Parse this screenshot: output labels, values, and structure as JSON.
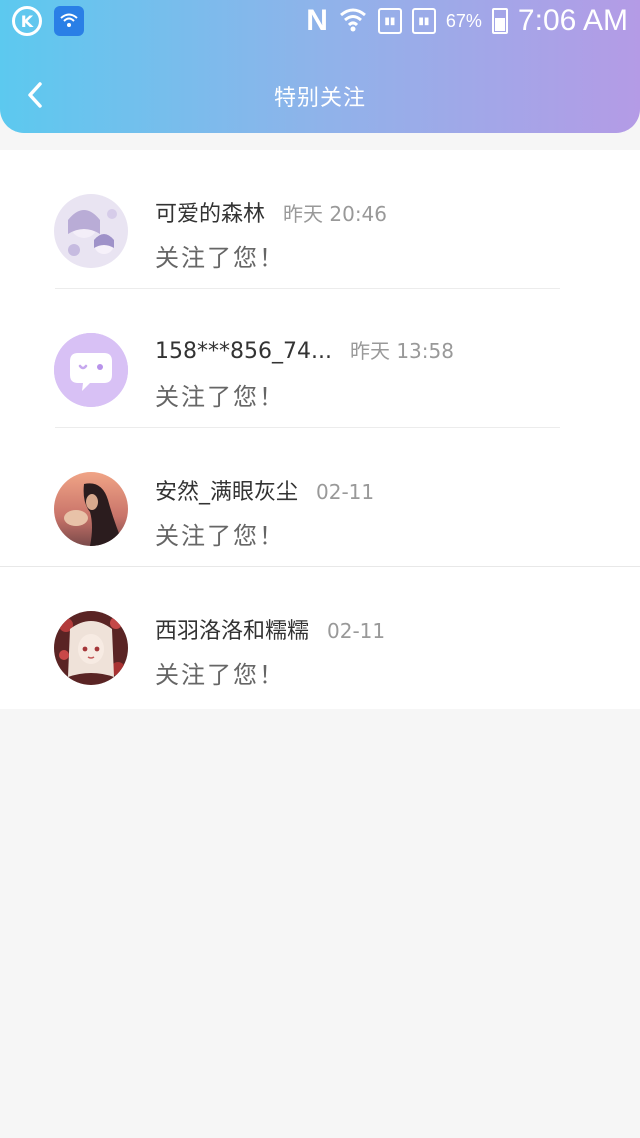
{
  "status_bar": {
    "battery": "67%",
    "time": "7:06 AM"
  },
  "nav": {
    "title": "特别关注"
  },
  "items": [
    {
      "name": "可爱的森林",
      "time": "昨天 20:46",
      "message": "关注了您！",
      "avatar": "avatar-anime-girl-purple"
    },
    {
      "name": "158***856_74...",
      "time": "昨天 13:58",
      "message": "关注了您！",
      "avatar": "avatar-default-chat-bubble"
    },
    {
      "name": "安然_满眼灰尘",
      "time": "02-11",
      "message": "关注了您！",
      "avatar": "avatar-photo-sunset-girl"
    },
    {
      "name": "西羽洛洛和糯糯",
      "time": "02-11",
      "message": "关注了您！",
      "avatar": "avatar-anime-girl-red"
    }
  ],
  "colors": {
    "header_gradient": [
      "#5cc9ef",
      "#8fb3ea",
      "#b49be6"
    ],
    "default_avatar_bg": "#d8c1f5"
  }
}
